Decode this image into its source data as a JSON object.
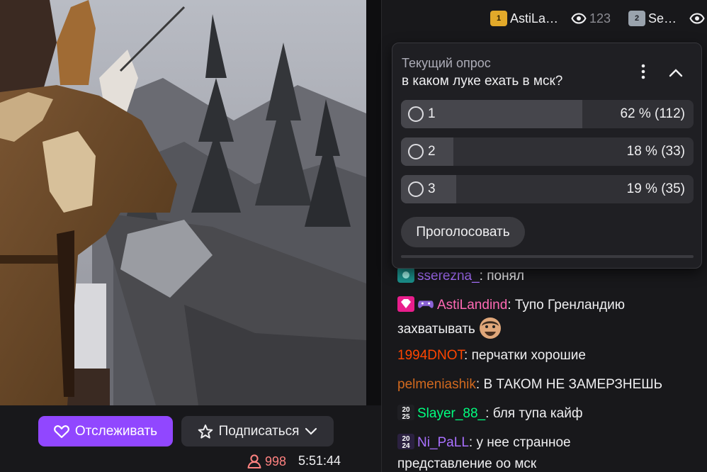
{
  "topbar": {
    "gifter1": {
      "rank": "1",
      "name": "AstiLa…",
      "views": "123"
    },
    "gifter2": {
      "rank": "2",
      "name": "Se…"
    }
  },
  "poll": {
    "label": "Текущий опрос",
    "question": "в каком луке ехать в мск?",
    "options": [
      {
        "label": "1",
        "result": "62 % (112)",
        "percent": 62
      },
      {
        "label": "2",
        "result": "18 % (33)",
        "percent": 18
      },
      {
        "label": "3",
        "result": "19 % (35)",
        "percent": 19
      }
    ],
    "vote_label": "Проголосовать"
  },
  "chat": [
    {
      "user": "ssereznа_",
      "user_color": "#a970ff",
      "text": "понял"
    },
    {
      "user": "AstiLandind",
      "user_color": "#ff69b4",
      "text_line1": "Тупо Гренландию",
      "text_line2": "захватывать"
    },
    {
      "user": "1994DNOT",
      "user_color": "#ff4500",
      "text": "перчатки хорошие"
    },
    {
      "user": "pelmeniashik",
      "user_color": "#d2691e",
      "text": "В ТАКОМ НЕ ЗАМЕРЗНЕШЬ"
    },
    {
      "badge_top": "20",
      "badge_bottom": "25",
      "user": "Slayer_88_",
      "user_color": "#00ff7f",
      "text": "бля тупа кайф"
    },
    {
      "badge_top": "20",
      "badge_bottom": "24",
      "user": "Ni_PaLL",
      "user_color": "#a970ff",
      "text_line1": "у нее странное",
      "text_line2": "представление оо мск"
    }
  ],
  "stream": {
    "follow_label": "Отслеживать",
    "subscribe_label": "Подписаться",
    "viewer_count": "998",
    "uptime": "5:51:44"
  },
  "colors": {
    "accent": "#9147ff",
    "viewer_red": "#ff8280"
  }
}
